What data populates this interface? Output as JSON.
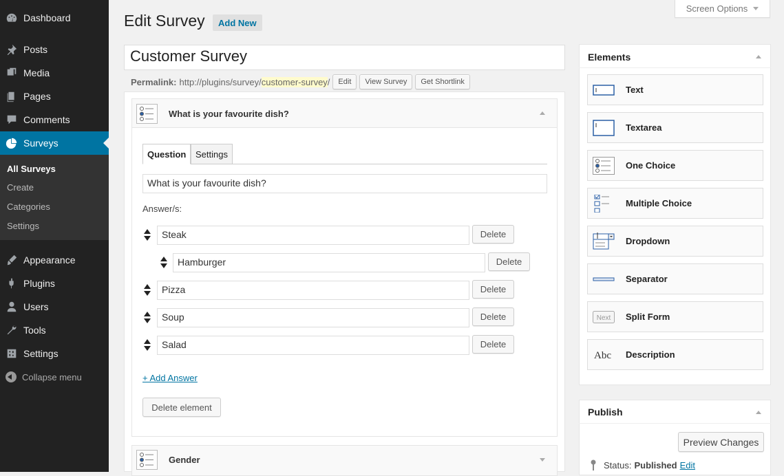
{
  "sidebar": {
    "items": [
      {
        "label": "Dashboard",
        "icon": "dashboard-icon"
      },
      {
        "label": "Posts",
        "icon": "pin-icon"
      },
      {
        "label": "Media",
        "icon": "media-icon"
      },
      {
        "label": "Pages",
        "icon": "pages-icon"
      },
      {
        "label": "Comments",
        "icon": "comments-icon"
      },
      {
        "label": "Surveys",
        "icon": "pie-chart-icon"
      },
      {
        "label": "Appearance",
        "icon": "brush-icon"
      },
      {
        "label": "Plugins",
        "icon": "plug-icon"
      },
      {
        "label": "Users",
        "icon": "user-icon"
      },
      {
        "label": "Tools",
        "icon": "wrench-icon"
      },
      {
        "label": "Settings",
        "icon": "settings-icon"
      }
    ],
    "submenu": [
      "All Surveys",
      "Create",
      "Categories",
      "Settings"
    ],
    "collapse_label": "Collapse menu",
    "accent_color": "#0074a2"
  },
  "header": {
    "screen_options": "Screen Options",
    "title": "Edit Survey",
    "add_new": "Add New"
  },
  "survey": {
    "title": "Customer Survey",
    "permalink_label": "Permalink:",
    "permalink_base": "http://plugins/survey/",
    "permalink_slug": "customer-survey",
    "permalink_end": "/",
    "edit_btn": "Edit",
    "view_btn": "View Survey",
    "shortlink_btn": "Get Shortlink"
  },
  "element1": {
    "title": "What is your favourite dish?",
    "tabs": [
      "Question",
      "Settings"
    ],
    "question": "What is your favourite dish?",
    "answers_label": "Answer/s:",
    "answers": [
      "Steak",
      "Hamburger",
      "Pizza",
      "Soup",
      "Salad"
    ],
    "delete_label": "Delete",
    "add_answer": "+ Add Answer",
    "delete_element": "Delete element"
  },
  "element2": {
    "title": "Gender"
  },
  "elements_panel": {
    "title": "Elements",
    "items": [
      "Text",
      "Textarea",
      "One Choice",
      "Multiple Choice",
      "Dropdown",
      "Separator",
      "Split Form",
      "Description"
    ],
    "split_icon_text": "Next",
    "desc_icon_text": "Abc"
  },
  "publish_panel": {
    "title": "Publish",
    "preview": "Preview Changes",
    "status_label": "Status:",
    "status_value": "Published",
    "status_edit": "Edit"
  }
}
